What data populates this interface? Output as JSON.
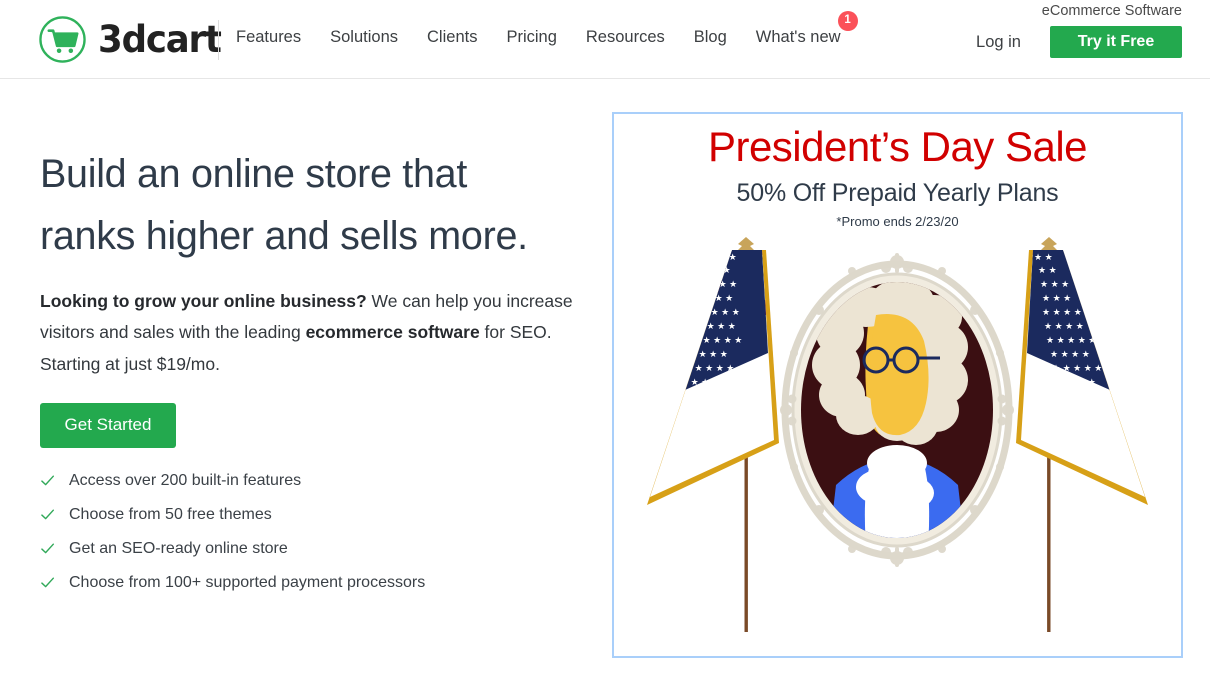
{
  "header": {
    "logo": {
      "icon": "shopping-cart-icon",
      "word": "3dcart",
      "color": "#2fb25b"
    },
    "nav": [
      {
        "label": "Features"
      },
      {
        "label": "Solutions"
      },
      {
        "label": "Clients"
      },
      {
        "label": "Pricing"
      },
      {
        "label": "Resources"
      },
      {
        "label": "Blog"
      },
      {
        "label": "What's new",
        "badge": "1"
      }
    ],
    "tagline": "eCommerce Software",
    "login_label": "Log in",
    "try_free_label": "Try it Free",
    "accent_green": "#23a94e",
    "badge_color": "#fb5159"
  },
  "hero": {
    "headline_line1": "Build an online store that",
    "headline_line2": "ranks higher and sells more.",
    "subcopy_bold_lead": "Looking to grow your online business?",
    "subcopy_mid": " We can help you increase visitors and sales with the leading ",
    "subcopy_bold_2": "ecommerce software",
    "subcopy_tail": " for SEO. Starting at just $19/mo.",
    "cta_label": "Get Started",
    "features": [
      {
        "icon": "check-icon",
        "label": "Access over 200 built-in features"
      },
      {
        "icon": "check-icon",
        "label": "Choose from 50 free themes"
      },
      {
        "icon": "check-icon",
        "label": "Get an SEO-ready online store"
      },
      {
        "icon": "check-icon",
        "label": "Choose from 100+ supported payment processors"
      }
    ]
  },
  "promo": {
    "title": "President’s Day Sale",
    "subtitle": "50% Off Prepaid Yearly Plans",
    "fine_print": "*Promo ends 2/23/20",
    "border_color": "#a9cffa",
    "title_color": "#d10000",
    "illustration": "presidents-day-portrait-with-flags"
  }
}
